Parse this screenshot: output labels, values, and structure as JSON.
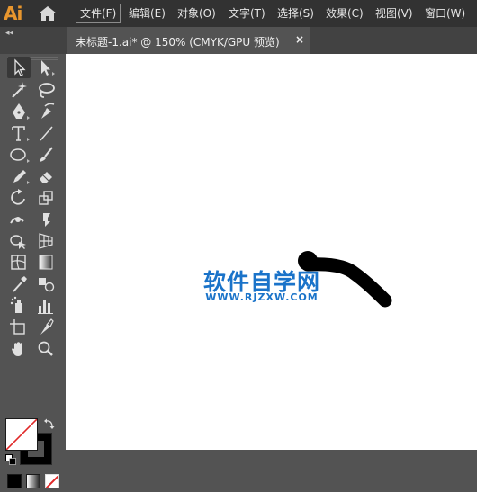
{
  "app": {
    "logo": "Ai",
    "home_icon": "home-icon"
  },
  "menu": [
    {
      "label": "文件(F)"
    },
    {
      "label": "编辑(E)"
    },
    {
      "label": "对象(O)"
    },
    {
      "label": "文字(T)"
    },
    {
      "label": "选择(S)"
    },
    {
      "label": "效果(C)"
    },
    {
      "label": "视图(V)"
    },
    {
      "label": "窗口(W)"
    }
  ],
  "panel_collapse": "◂◂",
  "document_tab": {
    "title": "未标题-1.ai* @ 150% (CMYK/GPU 预览)",
    "close": "×"
  },
  "tools": [
    "selection-tool-icon",
    "direct-selection-tool-icon",
    "magic-wand-tool-icon",
    "lasso-tool-icon",
    "pen-tool-icon",
    "curvature-tool-icon",
    "type-tool-icon",
    "line-segment-tool-icon",
    "ellipse-tool-icon",
    "paintbrush-tool-icon",
    "pencil-tool-icon",
    "eraser-tool-icon",
    "rotate-tool-icon",
    "scale-tool-icon",
    "width-tool-icon",
    "puppet-warp-tool-icon",
    "shape-builder-tool-icon",
    "perspective-grid-tool-icon",
    "mesh-tool-icon",
    "gradient-tool-icon",
    "eyedropper-tool-icon",
    "blend-tool-icon",
    "symbol-sprayer-tool-icon",
    "column-graph-tool-icon",
    "artboard-tool-icon",
    "slice-tool-icon",
    "hand-tool-icon",
    "zoom-tool-icon"
  ],
  "colors": {
    "fill": "#ffffff",
    "stroke": "#000000",
    "accent": "#e8962e",
    "watermark": "#1a73c9"
  },
  "watermark": {
    "title": "软件自学网",
    "url": "WWW.RJZXW.COM"
  }
}
